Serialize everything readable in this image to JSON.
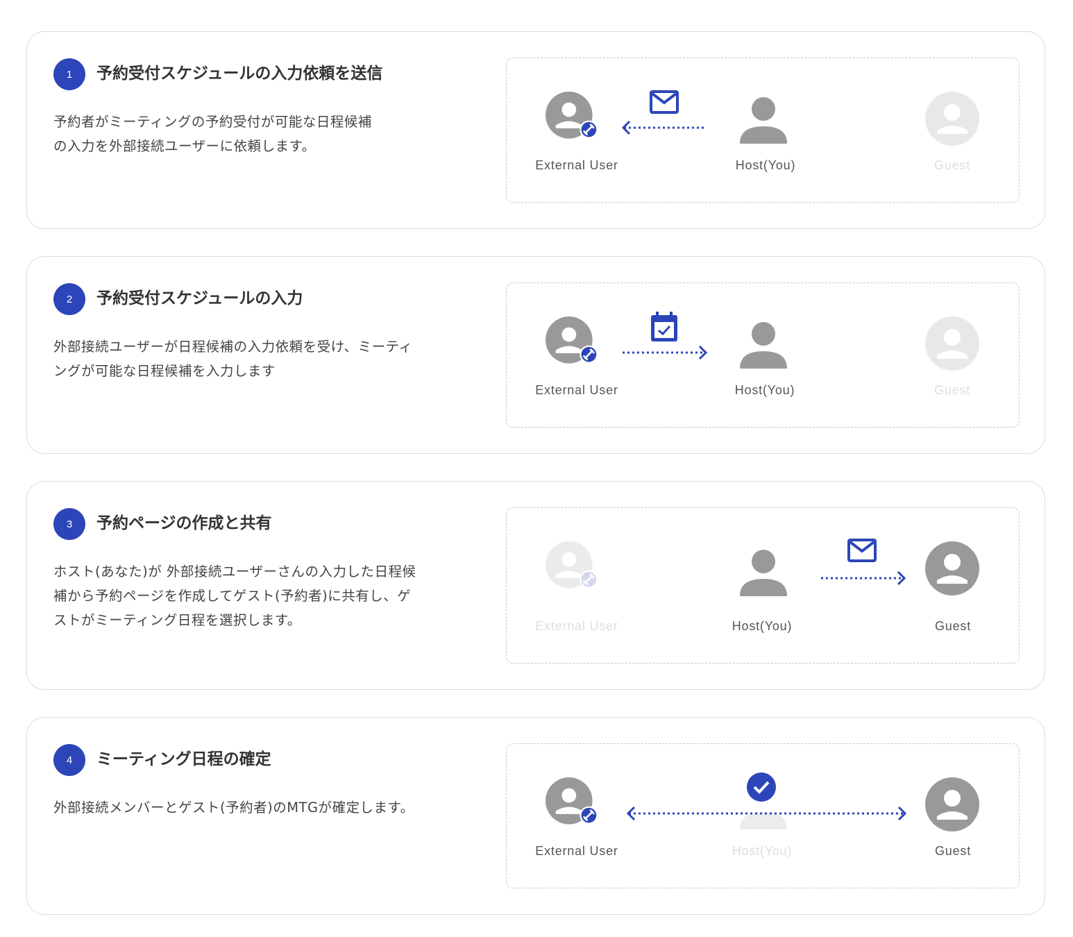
{
  "colors": {
    "accent": "#2c45b8",
    "avatar": "#999999",
    "avatar_faded": "#e8e8e8",
    "text": "#333333",
    "text_faded": "#dedede"
  },
  "steps": [
    {
      "number": "1",
      "title": "予約受付スケジュールの入力依頼を送信",
      "desc_lines": [
        "予約者がミーティングの予約受付が可能な日程候補",
        "の入力を外部接続ユーザーに依頼します。"
      ],
      "labels": {
        "external": "External User",
        "host": "Host(You)",
        "guest": "Guest"
      }
    },
    {
      "number": "2",
      "title": "予約受付スケジュールの入力",
      "desc_lines": [
        "外部接続ユーザーが日程候補の入力依頼を受け、ミーティ",
        "ングが可能な日程候補を入力します"
      ],
      "labels": {
        "external": "External User",
        "host": "Host(You)",
        "guest": "Guest"
      }
    },
    {
      "number": "3",
      "title": "予約ページの作成と共有",
      "desc_lines": [
        "ホスト(あなた)が 外部接続ユーザーさんの入力した日程候",
        "補から予約ページを作成してゲスト(予約者)に共有し、ゲ",
        "ストがミーティング日程を選択します。"
      ],
      "labels": {
        "external": "External User",
        "host": "Host(You)",
        "guest": "Guest"
      }
    },
    {
      "number": "4",
      "title": "ミーティング日程の確定",
      "desc_lines": [
        "外部接続メンバーとゲスト(予約者)のMTGが確定します。"
      ],
      "labels": {
        "external": "External User",
        "host": "Host(You)",
        "guest": "Guest"
      }
    }
  ]
}
